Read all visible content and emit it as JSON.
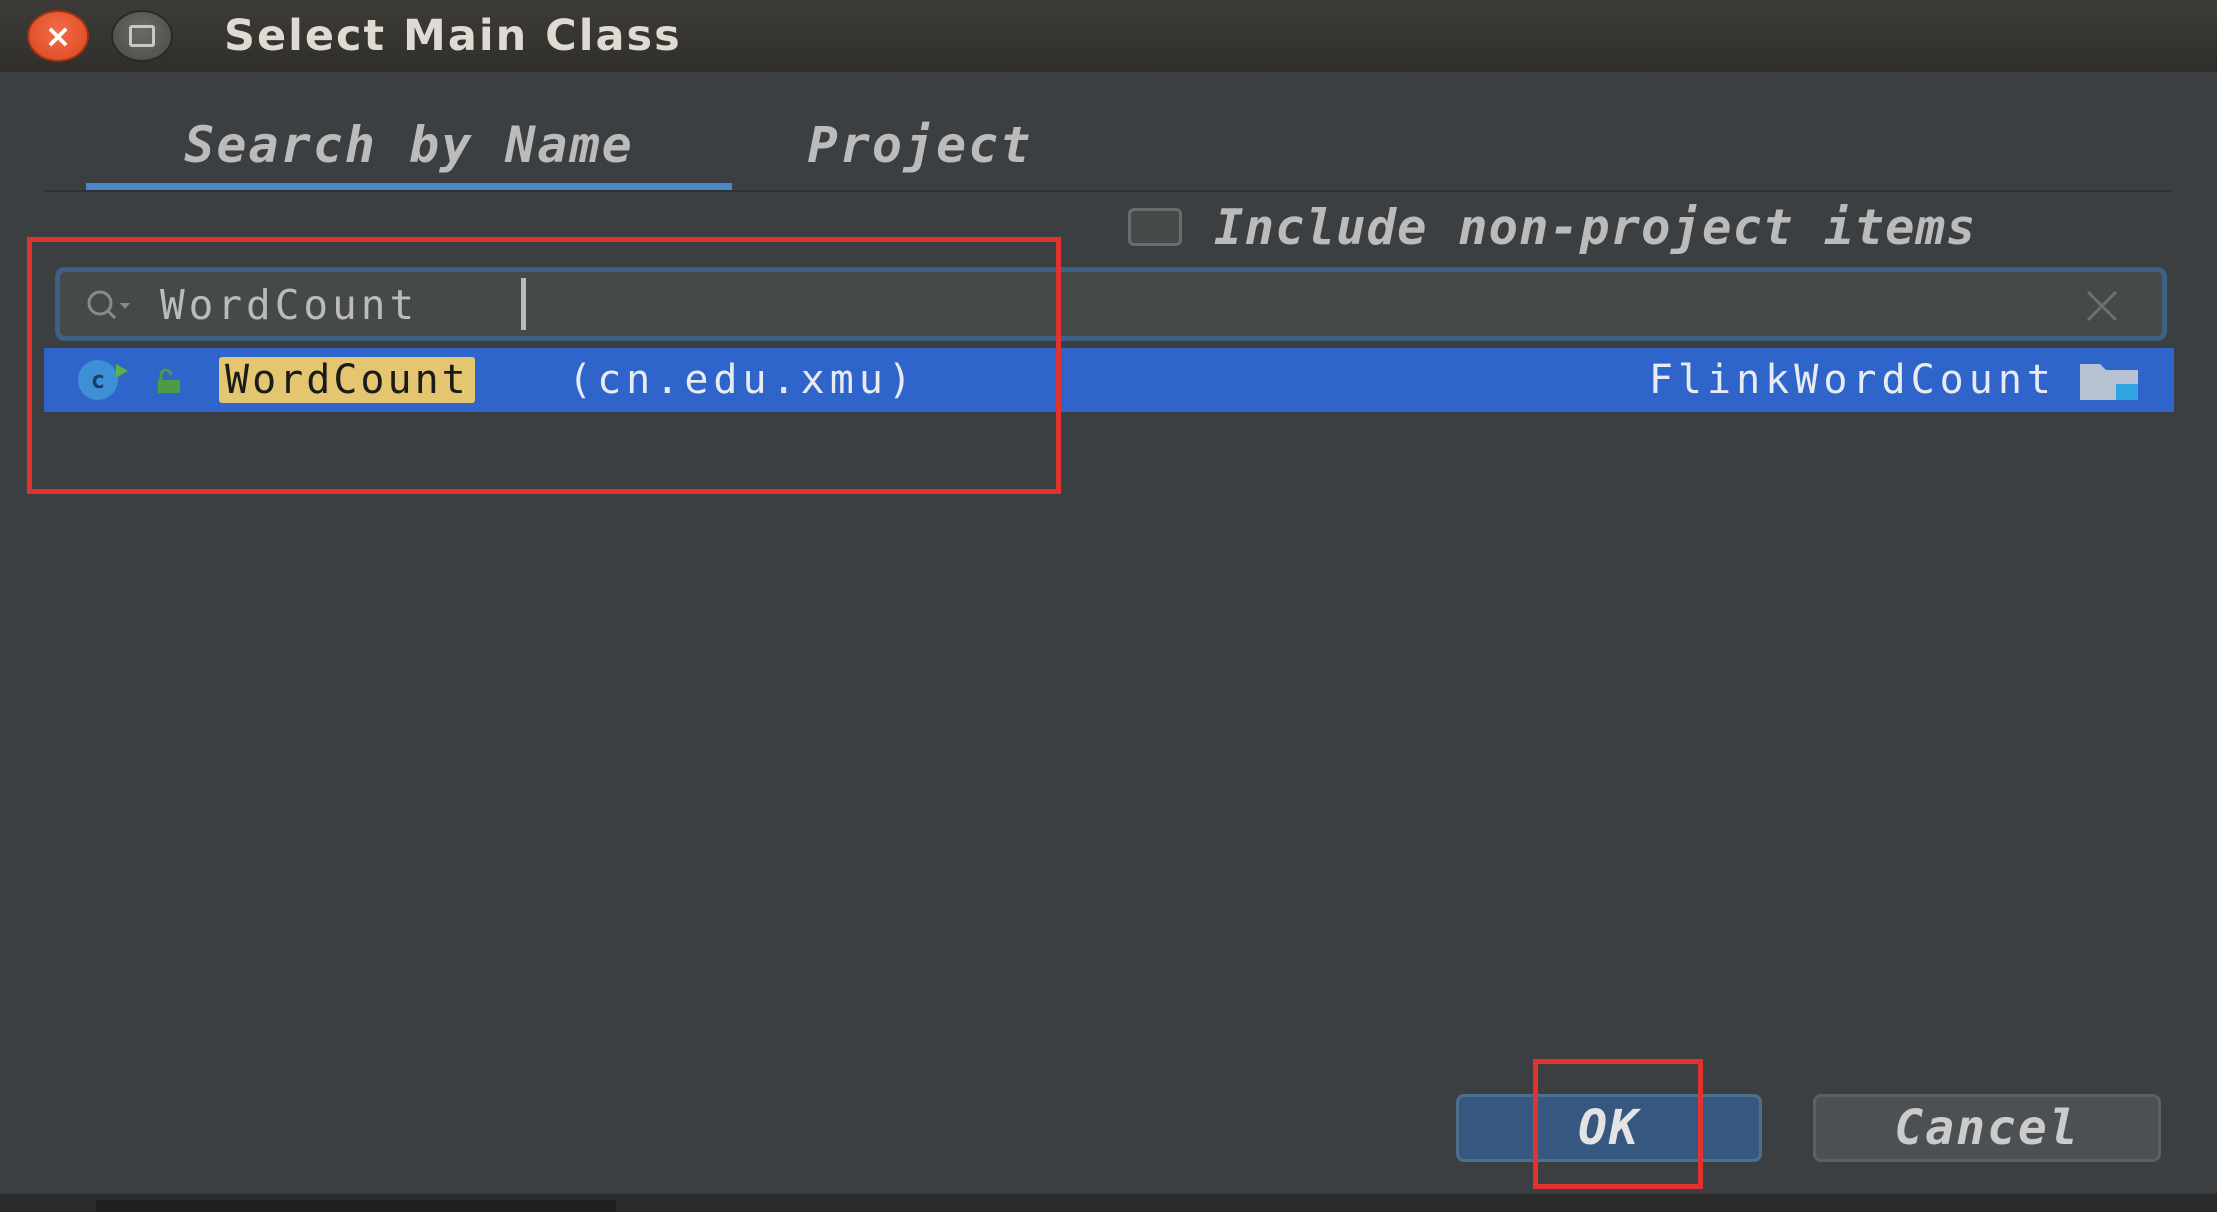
{
  "window": {
    "title": "Select Main Class"
  },
  "tabs": {
    "search_by_name": "Search by Name",
    "project": "Project"
  },
  "options": {
    "include_non_project_label": "Include non-project items",
    "include_non_project_checked": false
  },
  "search": {
    "value": "WordCount"
  },
  "results": [
    {
      "name": "WordCount",
      "package": "(cn.edu.xmu)",
      "module": "FlinkWordCount",
      "selected": true
    }
  ],
  "buttons": {
    "ok": "OK",
    "cancel": "Cancel"
  },
  "colors": {
    "background": "#3c3f41",
    "selection": "#2f65ca",
    "match_highlight": "#e3c66f",
    "tab_underline": "#4a88c7",
    "annotation": "#e0332f"
  }
}
